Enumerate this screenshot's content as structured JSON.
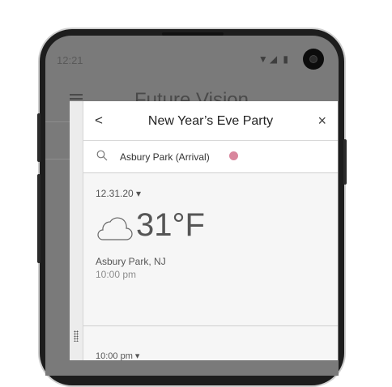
{
  "status_bar": {
    "time": "12:21",
    "icons": [
      "wifi-icon",
      "signal-icon",
      "battery-icon"
    ]
  },
  "background_app": {
    "title": "Future Vision"
  },
  "panel": {
    "title": "New Year’s Eve Party",
    "back_label": "<",
    "close_label": "×",
    "search": {
      "value": "Asbury Park (Arrival)",
      "dot_color": "#d9869d"
    },
    "weather_entries": [
      {
        "date": "12.31.20 ▾",
        "icon": "cloud-icon",
        "temperature": "31°F",
        "location": "Asbury Park, NJ",
        "time": "10:00 pm"
      },
      {
        "date": "10:00 pm ▾"
      }
    ]
  }
}
